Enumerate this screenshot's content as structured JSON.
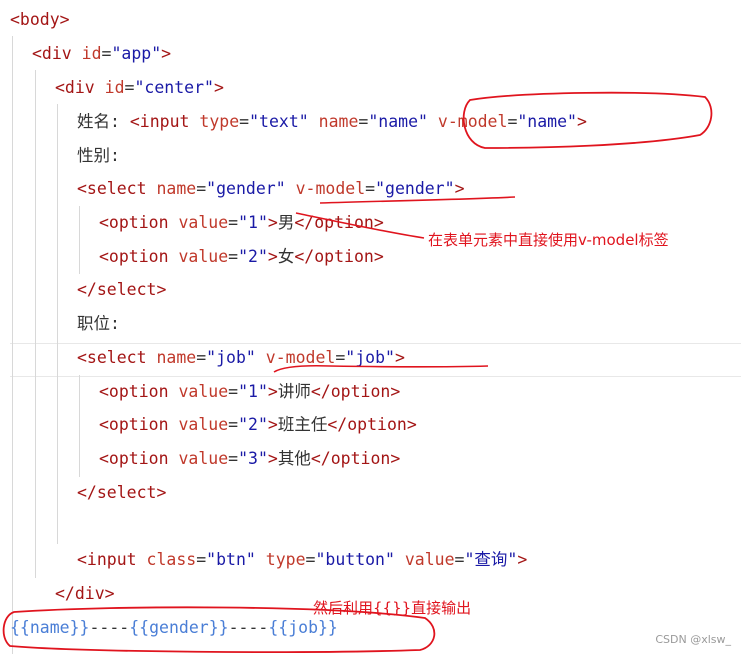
{
  "code": {
    "body_open": "<body>",
    "app_div": {
      "p1": "<div ",
      "attr": "id",
      "eq": "=",
      "val": "\"app\"",
      "close": ">"
    },
    "center_div": {
      "p1": "<div ",
      "attr": "id",
      "eq": "=",
      "val": "\"center\"",
      "close": ">"
    },
    "name_row": {
      "label": "姓名: ",
      "open": "<input ",
      "a1": "type",
      "v1": "\"text\"",
      "a2": "name",
      "v2": "\"name\"",
      "a3": "v-model",
      "v3": "\"name\"",
      "close": ">"
    },
    "gender_label": "性别:",
    "gender_select": {
      "open": "<select ",
      "a1": "name",
      "v1": "\"gender\"",
      "a2": "v-model",
      "v2": "\"gender\"",
      "close": ">"
    },
    "gender_options": [
      {
        "open": "<option ",
        "attr": "value",
        "val": "\"1\"",
        "gt": ">",
        "text": "男",
        "close": "</option>"
      },
      {
        "open": "<option ",
        "attr": "value",
        "val": "\"2\"",
        "gt": ">",
        "text": "女",
        "close": "</option>"
      }
    ],
    "select_close": "</select>",
    "job_label": "职位:",
    "job_select": {
      "open": "<select ",
      "a1": "name",
      "v1": "\"job\"",
      "a2": "v-model",
      "v2": "\"job\"",
      "close": ">"
    },
    "job_options": [
      {
        "open": "<option ",
        "attr": "value",
        "val": "\"1\"",
        "gt": ">",
        "text": "讲师",
        "close": "</option>"
      },
      {
        "open": "<option ",
        "attr": "value",
        "val": "\"2\"",
        "gt": ">",
        "text": "班主任",
        "close": "</option>"
      },
      {
        "open": "<option ",
        "attr": "value",
        "val": "\"3\"",
        "gt": ">",
        "text": "其他",
        "close": "</option>"
      }
    ],
    "button_row": {
      "open": "<input ",
      "a1": "class",
      "v1": "\"btn\"",
      "a2": "type",
      "v2": "\"button\"",
      "a3": "value",
      "v3": "\"查询\"",
      "close": ">"
    },
    "div_close": "</div>",
    "output_line": {
      "b1": "{{name}}",
      "sep1": "----",
      "b2": "{{gender}}",
      "sep2": "----",
      "b3": "{{job}}"
    }
  },
  "annotations": {
    "vmodel_note": "在表单元素中直接使用v-model标签",
    "output_note": "然后利用{{}}直接输出"
  },
  "watermark": "CSDN @xlsw_",
  "colors": {
    "tag": "#a31515",
    "attr": "#c0392b",
    "value": "#1a1aa6",
    "annotation": "#e0141e"
  }
}
